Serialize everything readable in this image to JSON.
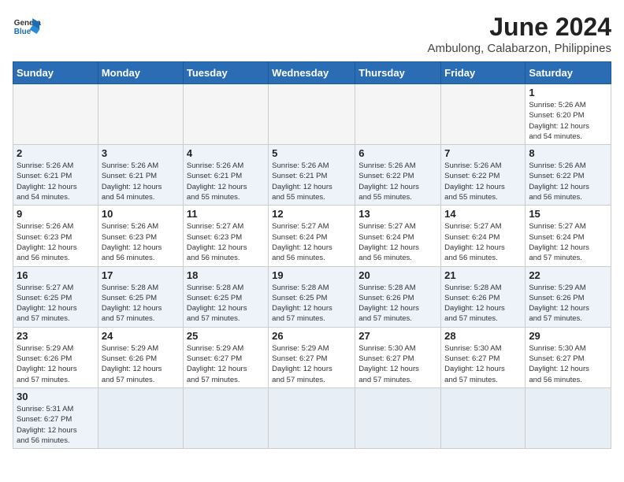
{
  "header": {
    "logo_general": "General",
    "logo_blue": "Blue",
    "month_year": "June 2024",
    "location": "Ambulong, Calabarzon, Philippines"
  },
  "weekdays": [
    "Sunday",
    "Monday",
    "Tuesday",
    "Wednesday",
    "Thursday",
    "Friday",
    "Saturday"
  ],
  "weeks": [
    [
      {
        "day": "",
        "info": ""
      },
      {
        "day": "",
        "info": ""
      },
      {
        "day": "",
        "info": ""
      },
      {
        "day": "",
        "info": ""
      },
      {
        "day": "",
        "info": ""
      },
      {
        "day": "",
        "info": ""
      },
      {
        "day": "1",
        "info": "Sunrise: 5:26 AM\nSunset: 6:20 PM\nDaylight: 12 hours\nand 54 minutes."
      }
    ],
    [
      {
        "day": "2",
        "info": "Sunrise: 5:26 AM\nSunset: 6:21 PM\nDaylight: 12 hours\nand 54 minutes."
      },
      {
        "day": "3",
        "info": "Sunrise: 5:26 AM\nSunset: 6:21 PM\nDaylight: 12 hours\nand 54 minutes."
      },
      {
        "day": "4",
        "info": "Sunrise: 5:26 AM\nSunset: 6:21 PM\nDaylight: 12 hours\nand 55 minutes."
      },
      {
        "day": "5",
        "info": "Sunrise: 5:26 AM\nSunset: 6:21 PM\nDaylight: 12 hours\nand 55 minutes."
      },
      {
        "day": "6",
        "info": "Sunrise: 5:26 AM\nSunset: 6:22 PM\nDaylight: 12 hours\nand 55 minutes."
      },
      {
        "day": "7",
        "info": "Sunrise: 5:26 AM\nSunset: 6:22 PM\nDaylight: 12 hours\nand 55 minutes."
      },
      {
        "day": "8",
        "info": "Sunrise: 5:26 AM\nSunset: 6:22 PM\nDaylight: 12 hours\nand 56 minutes."
      }
    ],
    [
      {
        "day": "9",
        "info": "Sunrise: 5:26 AM\nSunset: 6:23 PM\nDaylight: 12 hours\nand 56 minutes."
      },
      {
        "day": "10",
        "info": "Sunrise: 5:26 AM\nSunset: 6:23 PM\nDaylight: 12 hours\nand 56 minutes."
      },
      {
        "day": "11",
        "info": "Sunrise: 5:27 AM\nSunset: 6:23 PM\nDaylight: 12 hours\nand 56 minutes."
      },
      {
        "day": "12",
        "info": "Sunrise: 5:27 AM\nSunset: 6:24 PM\nDaylight: 12 hours\nand 56 minutes."
      },
      {
        "day": "13",
        "info": "Sunrise: 5:27 AM\nSunset: 6:24 PM\nDaylight: 12 hours\nand 56 minutes."
      },
      {
        "day": "14",
        "info": "Sunrise: 5:27 AM\nSunset: 6:24 PM\nDaylight: 12 hours\nand 56 minutes."
      },
      {
        "day": "15",
        "info": "Sunrise: 5:27 AM\nSunset: 6:24 PM\nDaylight: 12 hours\nand 57 minutes."
      }
    ],
    [
      {
        "day": "16",
        "info": "Sunrise: 5:27 AM\nSunset: 6:25 PM\nDaylight: 12 hours\nand 57 minutes."
      },
      {
        "day": "17",
        "info": "Sunrise: 5:28 AM\nSunset: 6:25 PM\nDaylight: 12 hours\nand 57 minutes."
      },
      {
        "day": "18",
        "info": "Sunrise: 5:28 AM\nSunset: 6:25 PM\nDaylight: 12 hours\nand 57 minutes."
      },
      {
        "day": "19",
        "info": "Sunrise: 5:28 AM\nSunset: 6:25 PM\nDaylight: 12 hours\nand 57 minutes."
      },
      {
        "day": "20",
        "info": "Sunrise: 5:28 AM\nSunset: 6:26 PM\nDaylight: 12 hours\nand 57 minutes."
      },
      {
        "day": "21",
        "info": "Sunrise: 5:28 AM\nSunset: 6:26 PM\nDaylight: 12 hours\nand 57 minutes."
      },
      {
        "day": "22",
        "info": "Sunrise: 5:29 AM\nSunset: 6:26 PM\nDaylight: 12 hours\nand 57 minutes."
      }
    ],
    [
      {
        "day": "23",
        "info": "Sunrise: 5:29 AM\nSunset: 6:26 PM\nDaylight: 12 hours\nand 57 minutes."
      },
      {
        "day": "24",
        "info": "Sunrise: 5:29 AM\nSunset: 6:26 PM\nDaylight: 12 hours\nand 57 minutes."
      },
      {
        "day": "25",
        "info": "Sunrise: 5:29 AM\nSunset: 6:27 PM\nDaylight: 12 hours\nand 57 minutes."
      },
      {
        "day": "26",
        "info": "Sunrise: 5:29 AM\nSunset: 6:27 PM\nDaylight: 12 hours\nand 57 minutes."
      },
      {
        "day": "27",
        "info": "Sunrise: 5:30 AM\nSunset: 6:27 PM\nDaylight: 12 hours\nand 57 minutes."
      },
      {
        "day": "28",
        "info": "Sunrise: 5:30 AM\nSunset: 6:27 PM\nDaylight: 12 hours\nand 57 minutes."
      },
      {
        "day": "29",
        "info": "Sunrise: 5:30 AM\nSunset: 6:27 PM\nDaylight: 12 hours\nand 56 minutes."
      }
    ],
    [
      {
        "day": "30",
        "info": "Sunrise: 5:31 AM\nSunset: 6:27 PM\nDaylight: 12 hours\nand 56 minutes."
      },
      {
        "day": "",
        "info": ""
      },
      {
        "day": "",
        "info": ""
      },
      {
        "day": "",
        "info": ""
      },
      {
        "day": "",
        "info": ""
      },
      {
        "day": "",
        "info": ""
      },
      {
        "day": "",
        "info": ""
      }
    ]
  ]
}
